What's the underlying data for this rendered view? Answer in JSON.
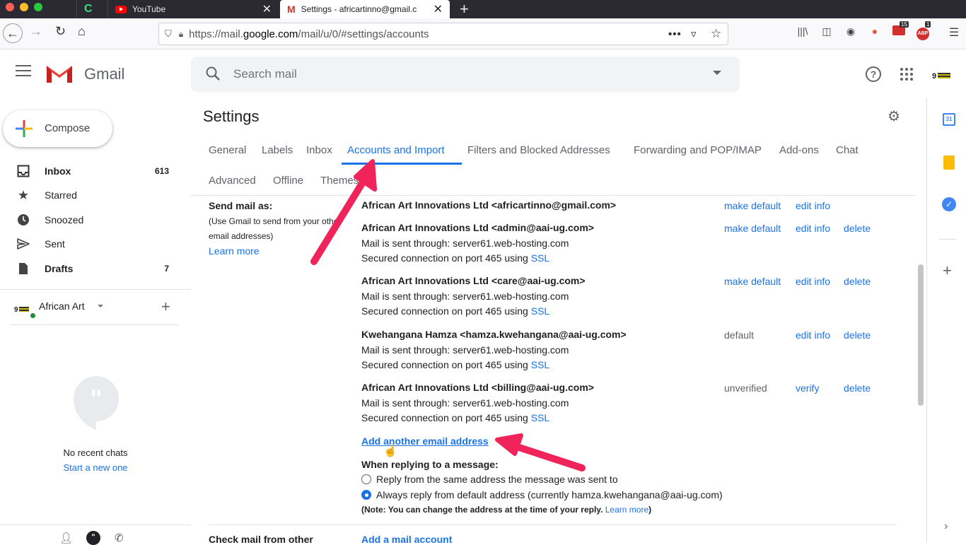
{
  "browser": {
    "tabs": [
      {
        "label": "",
        "icon": "c-app-icon"
      },
      {
        "label": "YouTube",
        "icon": "youtube-icon"
      },
      {
        "label": "Settings - africartinno@gmail.c",
        "icon": "gmail-icon"
      }
    ],
    "url_prefix": "https://mail.",
    "url_domain": "google.com",
    "url_path": "/mail/u/0/#settings/accounts",
    "badge_1": "15",
    "badge_2": "1"
  },
  "gmail": {
    "brand": "Gmail",
    "search_placeholder": "Search mail",
    "compose": "Compose",
    "nav": [
      {
        "label": "Inbox",
        "count": "613",
        "icon": "inbox-icon"
      },
      {
        "label": "Starred",
        "count": "",
        "icon": "star-icon"
      },
      {
        "label": "Snoozed",
        "count": "",
        "icon": "clock-icon"
      },
      {
        "label": "Sent",
        "count": "",
        "icon": "send-icon"
      },
      {
        "label": "Drafts",
        "count": "7",
        "icon": "draft-icon"
      }
    ],
    "hangouts_user": "African Art",
    "no_chats": "No recent chats",
    "start_new": "Start a new one"
  },
  "settings": {
    "title": "Settings",
    "tabs_row1": [
      "General",
      "Labels",
      "Inbox",
      "Accounts and Import",
      "Filters and Blocked Addresses",
      "Forwarding and POP/IMAP",
      "Add-ons",
      "Chat"
    ],
    "tabs_row2": [
      "Advanced",
      "Offline",
      "Themes"
    ],
    "send_mail_as": {
      "heading": "Send mail as:",
      "desc1": "(Use Gmail to send from your other",
      "desc2": "email addresses)",
      "learn_more": "Learn more"
    },
    "accounts": [
      {
        "name": "African Art Innovations Ltd <africartinno@gmail.com>",
        "server": "",
        "secure": "",
        "ssl": "",
        "status": "",
        "a1": "make default",
        "a2": "edit info",
        "a3": ""
      },
      {
        "name": "African Art Innovations Ltd <admin@aai-ug.com>",
        "server": "Mail is sent through: server61.web-hosting.com",
        "secure": "Secured connection on port 465 using",
        "ssl": "SSL",
        "status": "",
        "a1": "make default",
        "a2": "edit info",
        "a3": "delete"
      },
      {
        "name": "African Art Innovations Ltd <care@aai-ug.com>",
        "server": "Mail is sent through: server61.web-hosting.com",
        "secure": "Secured connection on port 465 using",
        "ssl": "SSL",
        "status": "",
        "a1": "make default",
        "a2": "edit info",
        "a3": "delete"
      },
      {
        "name": "Kwehangana Hamza <hamza.kwehangana@aai-ug.com>",
        "server": "Mail is sent through: server61.web-hosting.com",
        "secure": "Secured connection on port 465 using",
        "ssl": "SSL",
        "status": "default",
        "a1": "",
        "a2": "edit info",
        "a3": "delete"
      },
      {
        "name": "African Art Innovations Ltd <billing@aai-ug.com>",
        "server": "Mail is sent through: server61.web-hosting.com",
        "secure": "Secured connection on port 465 using",
        "ssl": "SSL",
        "status": "unverified",
        "a1": "",
        "a2": "verify",
        "a3": "delete"
      }
    ],
    "add_another": "Add another email address",
    "reply_heading": "When replying to a message:",
    "reply_opt1": "Reply from the same address the message was sent to",
    "reply_opt2": "Always reply from default address (currently hamza.kwehangana@aai-ug.com)",
    "note": "(Note: You can change the address at the time of your reply.",
    "note_link": "Learn more",
    "note_end": ")",
    "check_mail": "Check mail from other",
    "add_mail_account": "Add a mail account"
  },
  "colors": {
    "accent": "#1a73e8",
    "arrow": "#f0245b"
  }
}
